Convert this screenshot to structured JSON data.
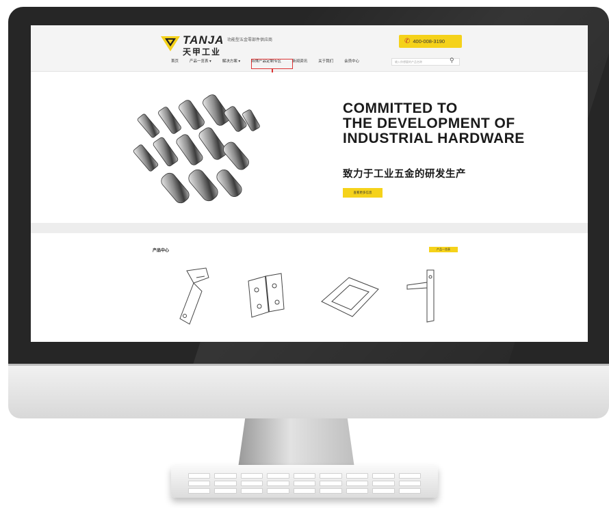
{
  "header": {
    "brand_en": "TANJA",
    "brand_cn": "天甲工业",
    "tagline": "功能型五金零部件供应商",
    "tagline_sub": "",
    "phone": "400-008-3190"
  },
  "nav": {
    "items": [
      {
        "label": "首页"
      },
      {
        "label": "产品一览表 ▾"
      },
      {
        "label": "解决方案 ▾"
      },
      {
        "label": "特殊产品定制专区"
      },
      {
        "label": "新闻资讯"
      },
      {
        "label": "关于我们"
      },
      {
        "label": "会员中心"
      }
    ],
    "search_placeholder": "输入你想要的产品名称"
  },
  "hero": {
    "title_lines": [
      "COMMITTED TO",
      "THE DEVELOPMENT OF",
      "INDUSTRIAL HARDWARE"
    ],
    "subtitle_cn": "致力于工业五金的研发生产",
    "button_label": "查看更多信息"
  },
  "products": {
    "title": "产品中心",
    "more_label": "产品一览表"
  },
  "colors": {
    "accent": "#f5d21a",
    "highlight": "#dd3333",
    "bezel": "#262626"
  },
  "icons": [
    "logo-mark-icon",
    "phone-icon",
    "search-icon"
  ]
}
